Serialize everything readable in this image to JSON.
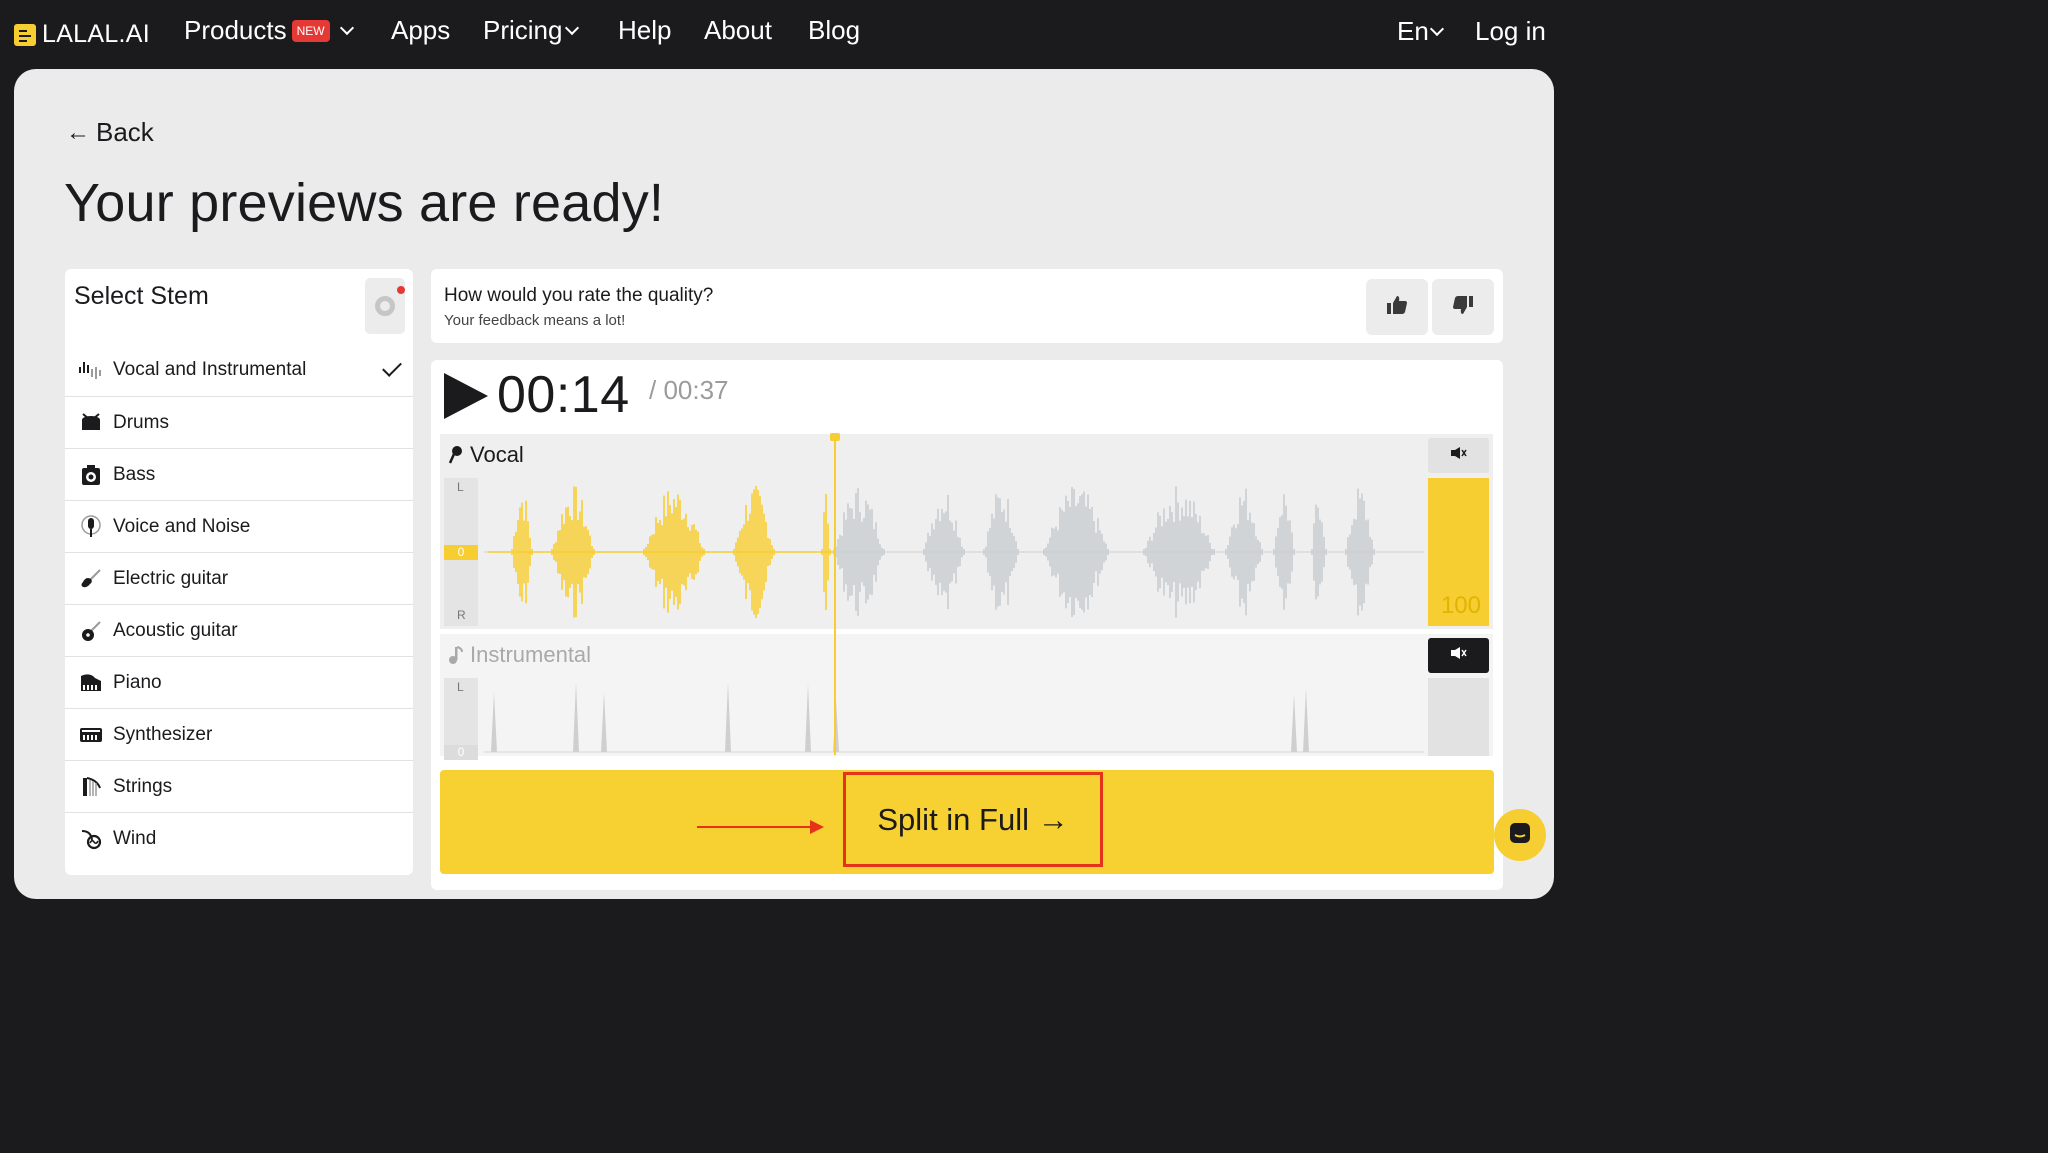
{
  "nav": {
    "logo": "LALAL.AI",
    "items": [
      {
        "label": "Products",
        "badge": "NEW"
      },
      {
        "label": "Apps"
      },
      {
        "label": "Pricing"
      },
      {
        "label": "Help"
      },
      {
        "label": "About"
      },
      {
        "label": "Blog"
      }
    ],
    "language": "En",
    "login": "Log in"
  },
  "page": {
    "back_label": "Back",
    "title": "Your previews are ready!"
  },
  "stems": {
    "heading": "Select Stem",
    "items": [
      {
        "label": "Vocal and Instrumental",
        "icon": "waveform-icon",
        "selected": true
      },
      {
        "label": "Drums",
        "icon": "drum-icon"
      },
      {
        "label": "Bass",
        "icon": "bass-amp-icon"
      },
      {
        "label": "Voice and Noise",
        "icon": "microphone-icon"
      },
      {
        "label": "Electric guitar",
        "icon": "electric-guitar-icon"
      },
      {
        "label": "Acoustic guitar",
        "icon": "acoustic-guitar-icon"
      },
      {
        "label": "Piano",
        "icon": "piano-icon"
      },
      {
        "label": "Synthesizer",
        "icon": "synthesizer-icon"
      },
      {
        "label": "Strings",
        "icon": "harp-icon"
      },
      {
        "label": "Wind",
        "icon": "horn-icon"
      }
    ]
  },
  "feedback": {
    "question": "How would you rate the quality?",
    "subtext": "Your feedback means a lot!"
  },
  "player": {
    "current_time": "00:14",
    "duration": "/ 00:37",
    "tracks": [
      {
        "name": "Vocal",
        "volume": "100",
        "muted": false,
        "left_label": "L",
        "right_label": "R",
        "zero_label": "0"
      },
      {
        "name": "Instrumental",
        "muted": true,
        "left_label": "L",
        "zero_label": "0"
      }
    ]
  },
  "cta": {
    "label": "Split in Full →"
  },
  "colors": {
    "accent": "#f7ce31",
    "highlight": "#e53319",
    "dark": "#1b1a1d"
  }
}
